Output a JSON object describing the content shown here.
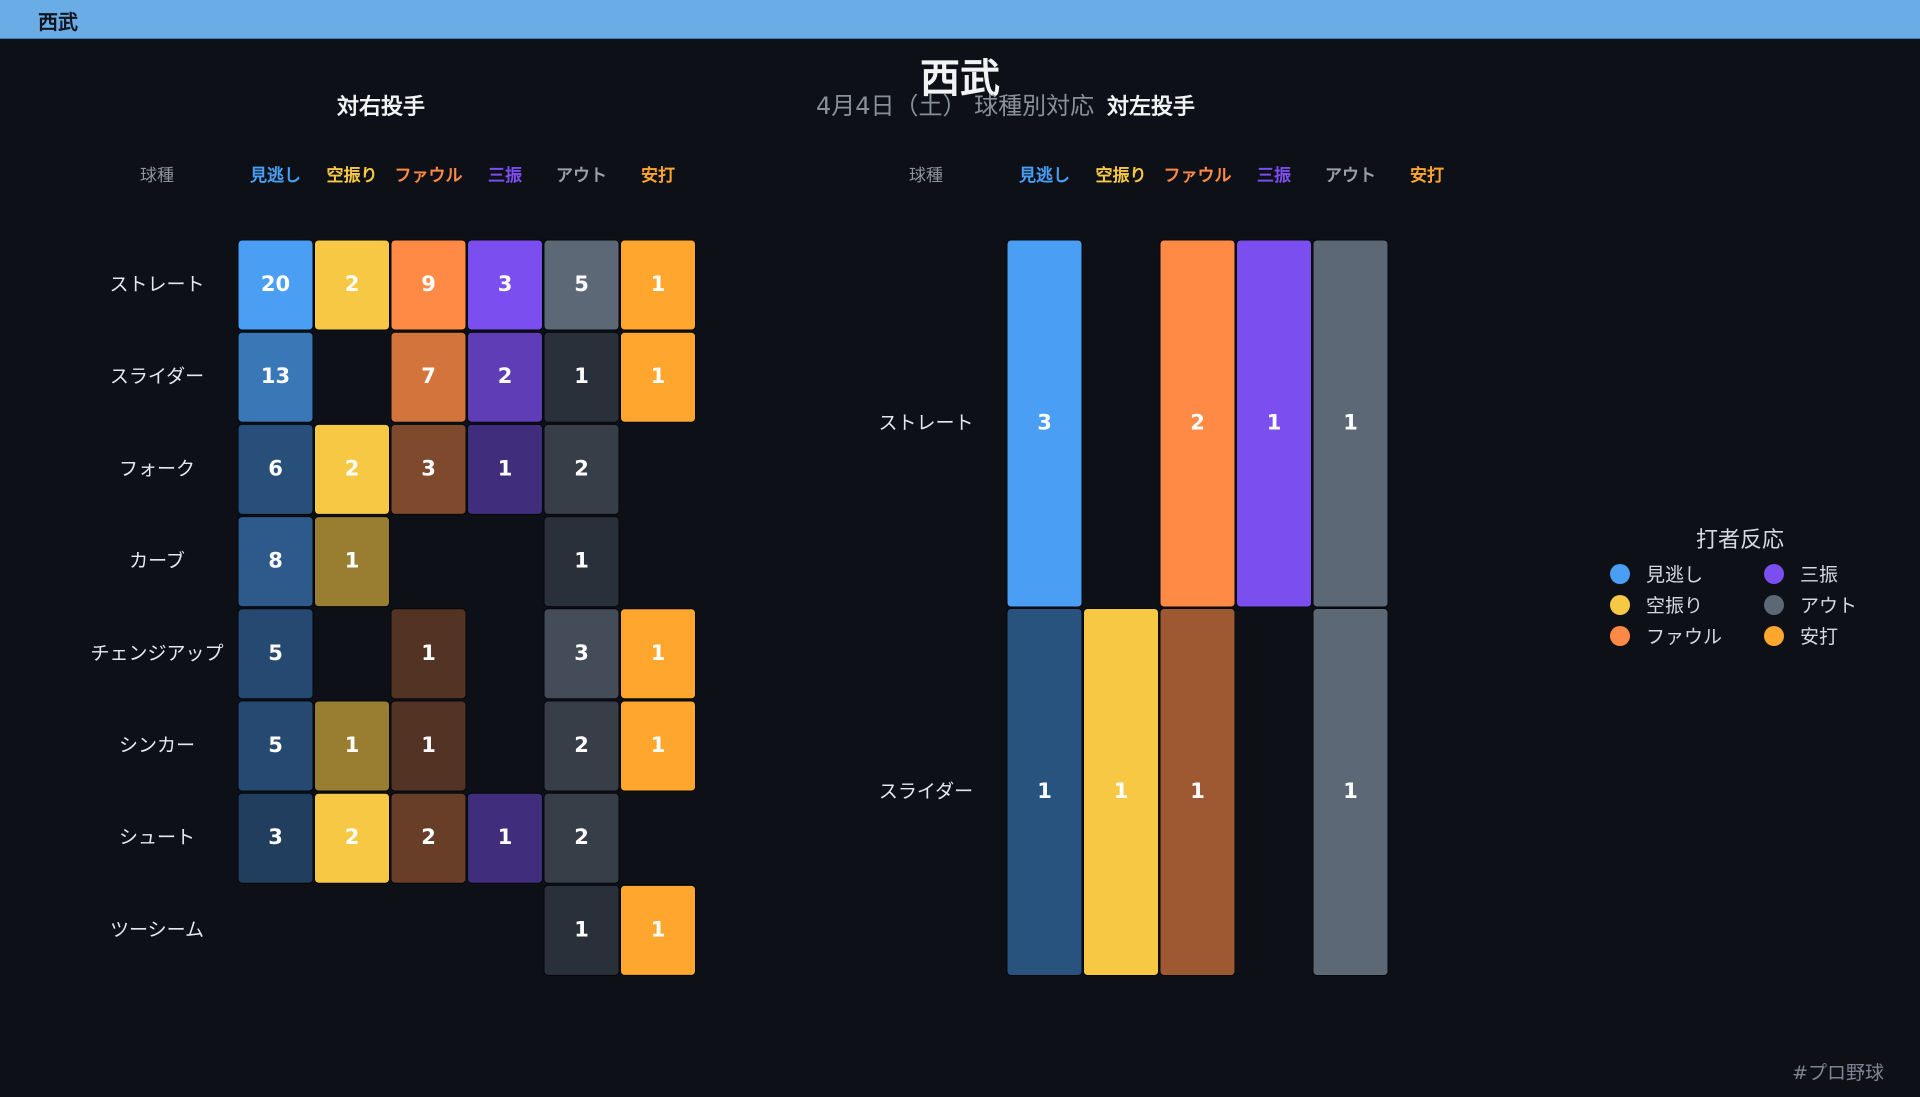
{
  "header": {
    "title": "西武"
  },
  "title": "西武",
  "subtitle": "4月4日（土） 球種別対応",
  "footer": "#プロ野球",
  "legend": {
    "title": "打者反応",
    "items": [
      {
        "label": "見逃し",
        "color": "#4a9ff5"
      },
      {
        "label": "三振",
        "color": "#7b4ef0"
      },
      {
        "label": "空振り",
        "color": "#f7c843"
      },
      {
        "label": "アウト",
        "color": "#5d6876"
      },
      {
        "label": "ファウル",
        "color": "#ff8a45"
      },
      {
        "label": "安打",
        "color": "#ffa62f"
      }
    ]
  },
  "chart_data": [
    {
      "type": "heatmap",
      "title": "対右投手",
      "row_header": "球種",
      "columns": [
        "見逃し",
        "空振り",
        "ファウル",
        "三振",
        "アウト",
        "安打"
      ],
      "column_colors": [
        "#4a9ff5",
        "#f7c843",
        "#ff8a45",
        "#7b4ef0",
        "#9aa0a6",
        "#ffa62f"
      ],
      "rows": [
        "ストレート",
        "スライダー",
        "フォーク",
        "カーブ",
        "チェンジアップ",
        "シンカー",
        "シュート",
        "ツーシーム"
      ],
      "values": [
        [
          20,
          2,
          9,
          3,
          5,
          1
        ],
        [
          13,
          null,
          7,
          2,
          1,
          1
        ],
        [
          6,
          2,
          3,
          1,
          2,
          null
        ],
        [
          8,
          1,
          null,
          null,
          1,
          null
        ],
        [
          5,
          null,
          1,
          null,
          3,
          1
        ],
        [
          5,
          1,
          1,
          null,
          2,
          1
        ],
        [
          3,
          2,
          2,
          1,
          2,
          null
        ],
        [
          null,
          null,
          null,
          null,
          1,
          1
        ]
      ]
    },
    {
      "type": "heatmap",
      "title": "対左投手",
      "row_header": "球種",
      "columns": [
        "見逃し",
        "空振り",
        "ファウル",
        "三振",
        "アウト",
        "安打"
      ],
      "column_colors": [
        "#4a9ff5",
        "#f7c843",
        "#ff8a45",
        "#7b4ef0",
        "#9aa0a6",
        "#ffa62f"
      ],
      "rows": [
        "ストレート",
        "スライダー"
      ],
      "values": [
        [
          3,
          null,
          2,
          1,
          1,
          null
        ],
        [
          1,
          1,
          1,
          null,
          1,
          null
        ]
      ]
    }
  ]
}
